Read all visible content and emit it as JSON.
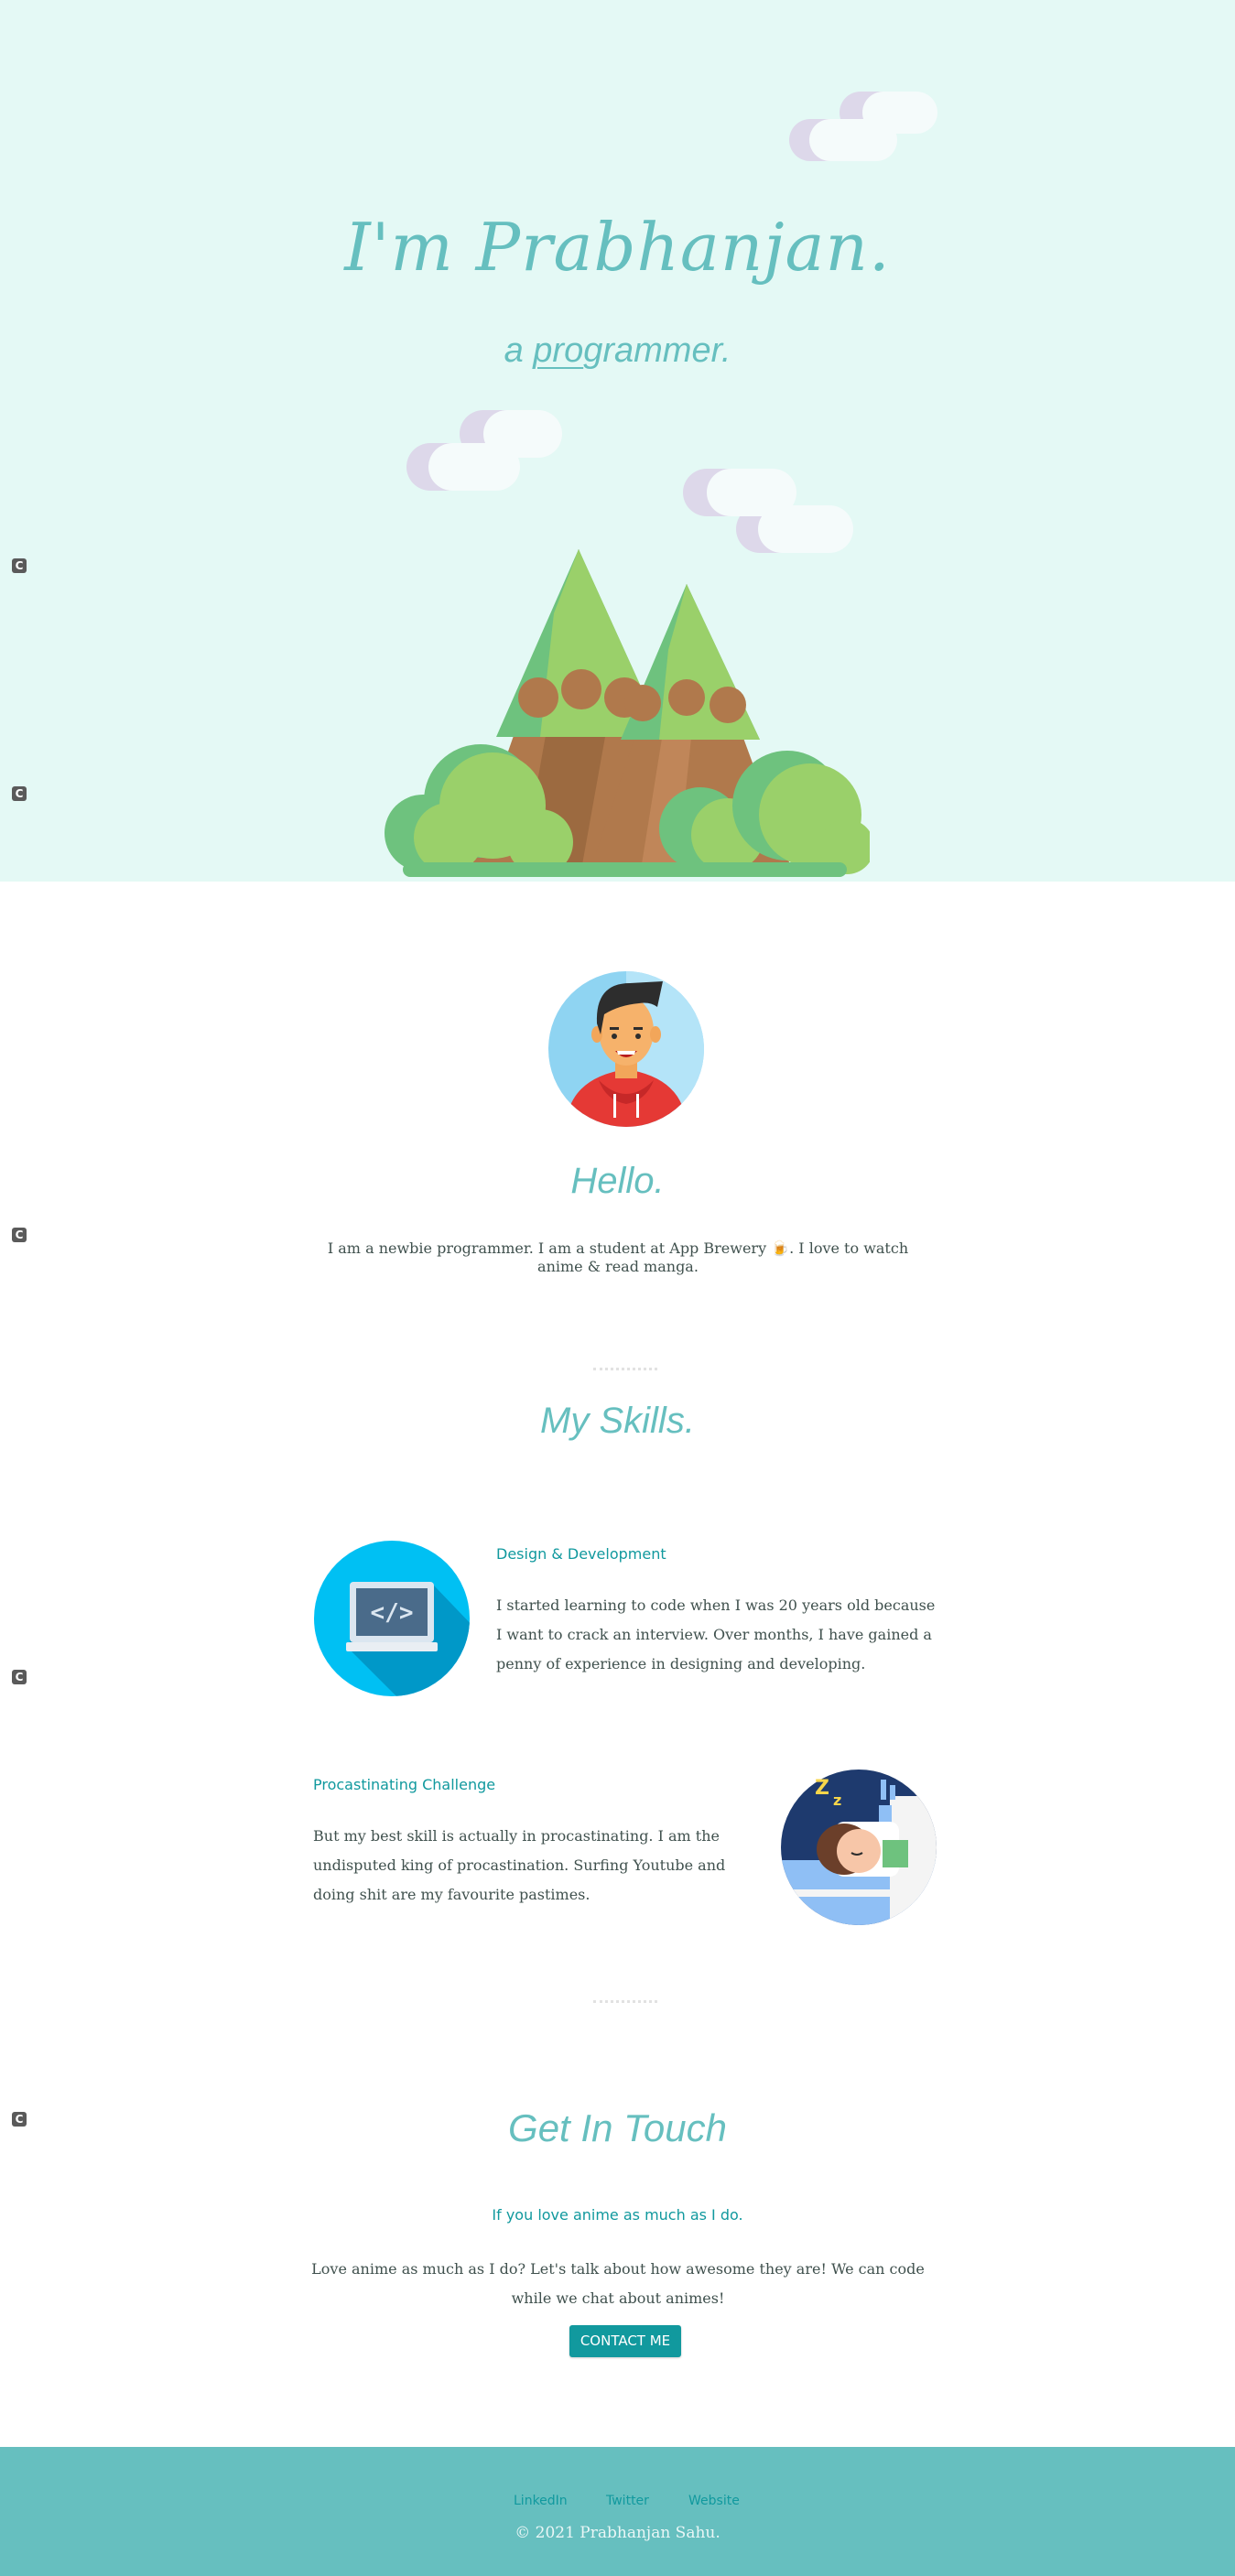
{
  "hero": {
    "title": "I'm Prabhanjan.",
    "subtitle_prefix": "a ",
    "subtitle_underlined": "pro",
    "subtitle_rest": "grammer."
  },
  "about": {
    "heading": "Hello.",
    "text": "I am a newbie programmer. I am a student at App Brewery 🍺. I love to watch anime & read manga."
  },
  "skills": {
    "heading": "My Skills.",
    "items": [
      {
        "title": "Design & Development",
        "text": "I started learning to code when I was 20 years old because I want to crack an interview. Over months, I have gained a penny of experience in designing and developing."
      },
      {
        "title": "Procastinating Challenge",
        "text": "But my best skill is actually in procastinating. I am the undisputed king of procastination. Surfing Youtube and doing shit are my favourite pastimes."
      }
    ]
  },
  "contact": {
    "heading": "Get In Touch",
    "subheading": "If you love anime as much as I do.",
    "text": "Love anime as much as I do? Let's talk about how awesome they are! We can code while we chat about animes!",
    "button": "CONTACT ME"
  },
  "footer": {
    "links": [
      "LinkedIn",
      "Twitter",
      "Website"
    ],
    "copyright": "© 2021 Prabhanjan Sahu."
  },
  "colors": {
    "hero_bg": "#e4f9f5",
    "accent": "#66bfbf",
    "accent_dark": "#11999e",
    "text": "#40514e"
  },
  "icons": [
    "mountain-illustration",
    "cloud-icon",
    "avatar",
    "laptop-code-icon",
    "sleeping-icon",
    "extension-icon"
  ]
}
